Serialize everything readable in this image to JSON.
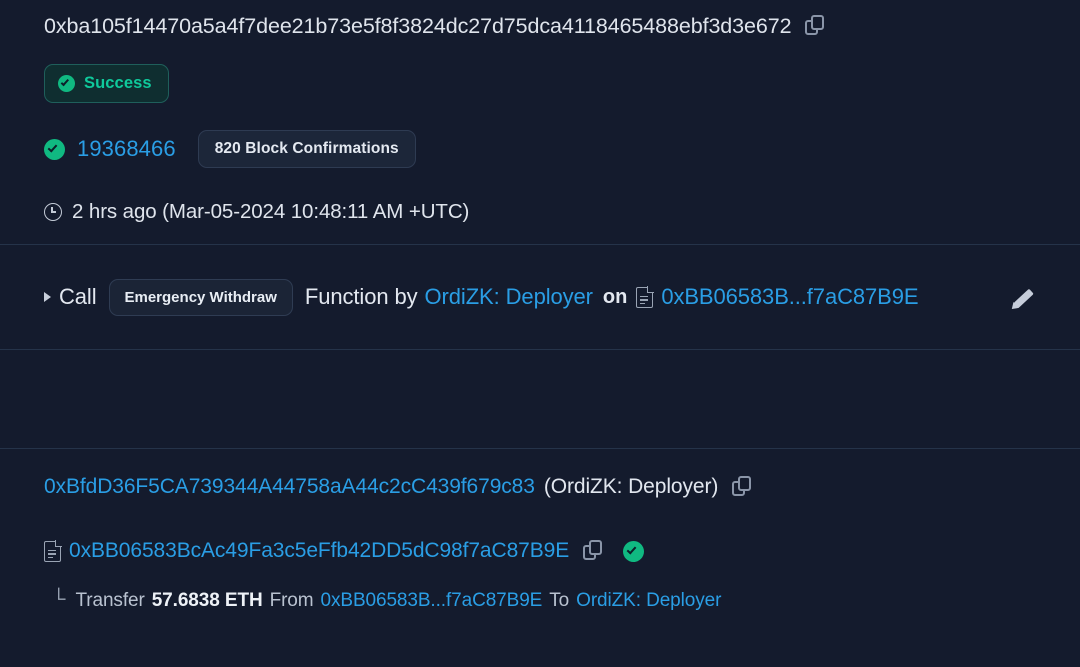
{
  "transaction": {
    "hash": "0xba105f14470a5a4f7dee21b73e5f8f3824dc27d75dca4118465488ebf3d3e672",
    "copy_icon": "copy-icon",
    "status": {
      "label": "Success",
      "icon": "check-circle-icon",
      "color": "#0fc99b",
      "background": "#0f2e30"
    },
    "block": {
      "icon": "check-circle-icon",
      "number": "19368466",
      "confirmations": "820 Block Confirmations"
    },
    "timestamp": {
      "icon": "clock-icon",
      "text": "2 hrs ago (Mar-05-2024 10:48:11 AM +UTC)"
    },
    "action": {
      "caret_icon": "caret-right-icon",
      "call_word": "Call",
      "function_name": "Emergency Withdraw",
      "function_word": "Function by",
      "by_name": "OrdiZK: Deployer",
      "on_word": "on",
      "contract_icon": "contract-doc-icon",
      "contract_short": "0xBB06583B...f7aC87B9E",
      "edit_icon": "pencil-icon"
    },
    "from": {
      "address": "0xBfdD36F5CA739344A44758aA44c2cC439f679c83",
      "name_tag": "(OrdiZK: Deployer)",
      "copy_icon": "copy-icon"
    },
    "to": {
      "contract_icon": "contract-doc-icon",
      "address": "0xBB06583BcAc49Fa3c5eFfb42DD5dC98f7aC87B9E",
      "copy_icon": "copy-icon",
      "verified_icon": "check-circle-icon"
    },
    "transfer": {
      "corner_glyph": "└",
      "label": "Transfer",
      "amount": "57.6838 ETH",
      "from_word": "From",
      "from_address": "0xBB06583B...f7aC87B9E",
      "to_word": "To",
      "to_name": "OrdiZK: Deployer"
    }
  },
  "theme": {
    "background": "#141b2d",
    "link": "#2a9ee5",
    "success": "#10b981",
    "divider": "#253349"
  }
}
